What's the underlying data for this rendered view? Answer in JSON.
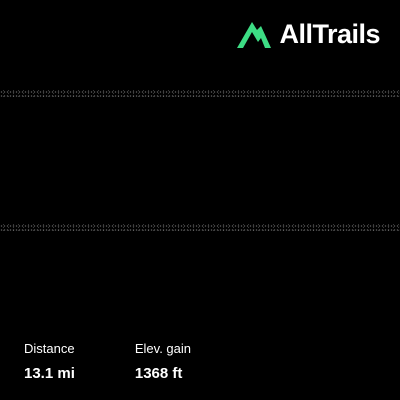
{
  "brand": {
    "name": "AllTrails",
    "accent_color": "#3ddc84",
    "icon": "mountain-logo-icon"
  },
  "stats": {
    "distance": {
      "label": "Distance",
      "value": "13.1 mi"
    },
    "elevation": {
      "label": "Elev. gain",
      "value": "1368 ft"
    }
  }
}
